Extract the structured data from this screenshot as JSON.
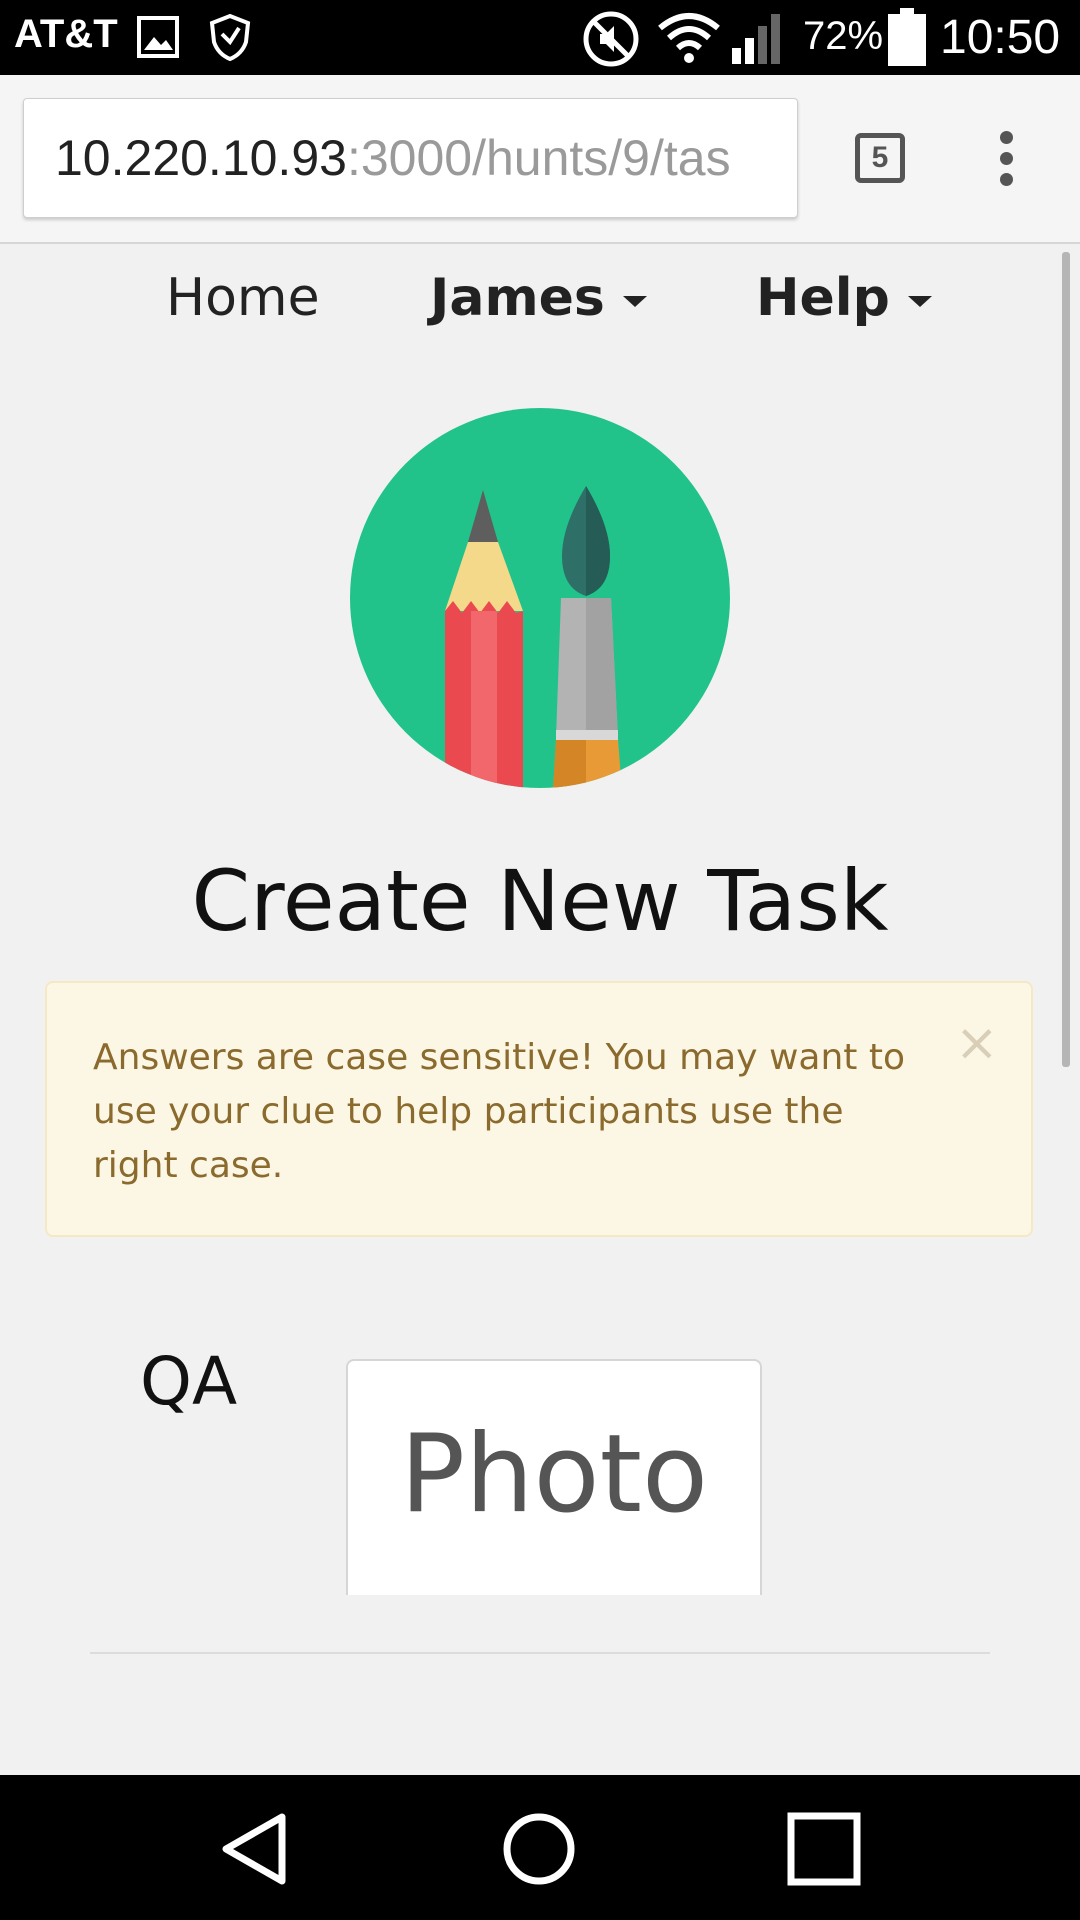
{
  "status_bar": {
    "carrier": "AT&T",
    "battery_percent": "72%",
    "time": "10:50",
    "icons": [
      "image-icon",
      "shield-icon",
      "mute-icon",
      "wifi-icon",
      "signal-icon",
      "battery-icon"
    ]
  },
  "browser": {
    "url_host": "10.220.10.93",
    "url_path": ":3000/hunts/9/tas",
    "tab_count": "5"
  },
  "nav": {
    "home": "Home",
    "user": "James",
    "help": "Help"
  },
  "page": {
    "title": "Create New Task",
    "alert_message": "Answers are case sensitive! You may want to use your clue to help participants use the right case.",
    "alert_close": "×",
    "qa_label": "QA",
    "photo_button": "Photo"
  },
  "colors": {
    "logo_circle": "#22c38a",
    "alert_bg": "#fcf7e5",
    "alert_text": "#8b6a2e"
  }
}
